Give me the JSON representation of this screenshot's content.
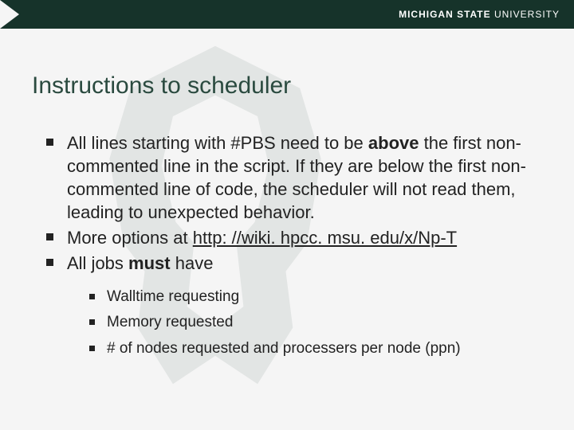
{
  "brand": {
    "bold": "MICHIGAN STATE",
    "light": " UNIVERSITY"
  },
  "title": "Instructions to scheduler",
  "bullets": {
    "b1": {
      "pre": "All lines starting with #PBS need to be ",
      "bold": "above",
      "post": " the first non-commented line in the script. If they are below the first non-commented line of code, the scheduler will not read them, leading to unexpected behavior."
    },
    "b2": {
      "pre": "More options at ",
      "link": "http: //wiki. hpcc. msu. edu/x/Np-T"
    },
    "b3": {
      "pre": "All jobs ",
      "bold": "must",
      "post": " have"
    }
  },
  "sub": {
    "s1": "Walltime requesting",
    "s2": "Memory requested",
    "s3": "# of nodes requested and processers per node (ppn)"
  }
}
